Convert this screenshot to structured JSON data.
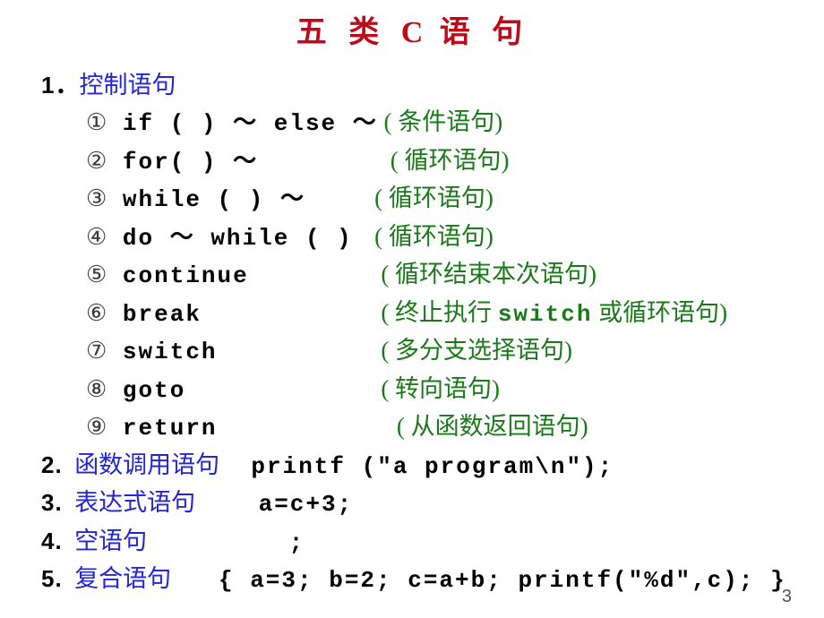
{
  "title": {
    "part1": "五 类 ",
    "c": "C",
    "part2": " 语 句"
  },
  "section1": {
    "num": "1",
    "dot": "．",
    "label": "控制语句",
    "items": [
      {
        "circ": "①",
        "code": " if ( ) ～ else ～",
        "note": " ( 条件语句)"
      },
      {
        "circ": "②",
        "code": " for( ) ～        ",
        "note": " ( 循环语句)"
      },
      {
        "circ": "③",
        "code": " while ( ) ～    ",
        "note": " ( 循环语句)"
      },
      {
        "circ": "④",
        "code": " do ～ while ( ) ",
        "note": " ( 循环语句)"
      },
      {
        "circ": "⑤",
        "code": " continue        ",
        "note": " ( 循环结束本次语句)"
      },
      {
        "circ": "⑥",
        "code": " break           ",
        "note_pre": " ( 终止执行 ",
        "note_mono": "switch",
        "note_post": " 或循环语句)"
      },
      {
        "circ": "⑦",
        "code": " switch          ",
        "note": " ( 多分支选择语句)"
      },
      {
        "circ": "⑧",
        "code": " goto            ",
        "note": " ( 转向语句)"
      },
      {
        "circ": "⑨",
        "code": " return           ",
        "note": " ( 从函数返回语句)"
      }
    ]
  },
  "section2": {
    "num": "2.",
    "label": "函数调用语句",
    "code": "  printf (\"a program\\n\");"
  },
  "section3": {
    "num": "3.",
    "label": "表达式语句",
    "code": "    a=c+3;"
  },
  "section4": {
    "num": "4.",
    "label": "空语句",
    "code": "         ;"
  },
  "section5": {
    "num": "5.",
    "label": "复合语句",
    "code": "   { a=3; b=2; c=a+b; printf(\"%d\",c); }"
  },
  "pageNumber": "3"
}
